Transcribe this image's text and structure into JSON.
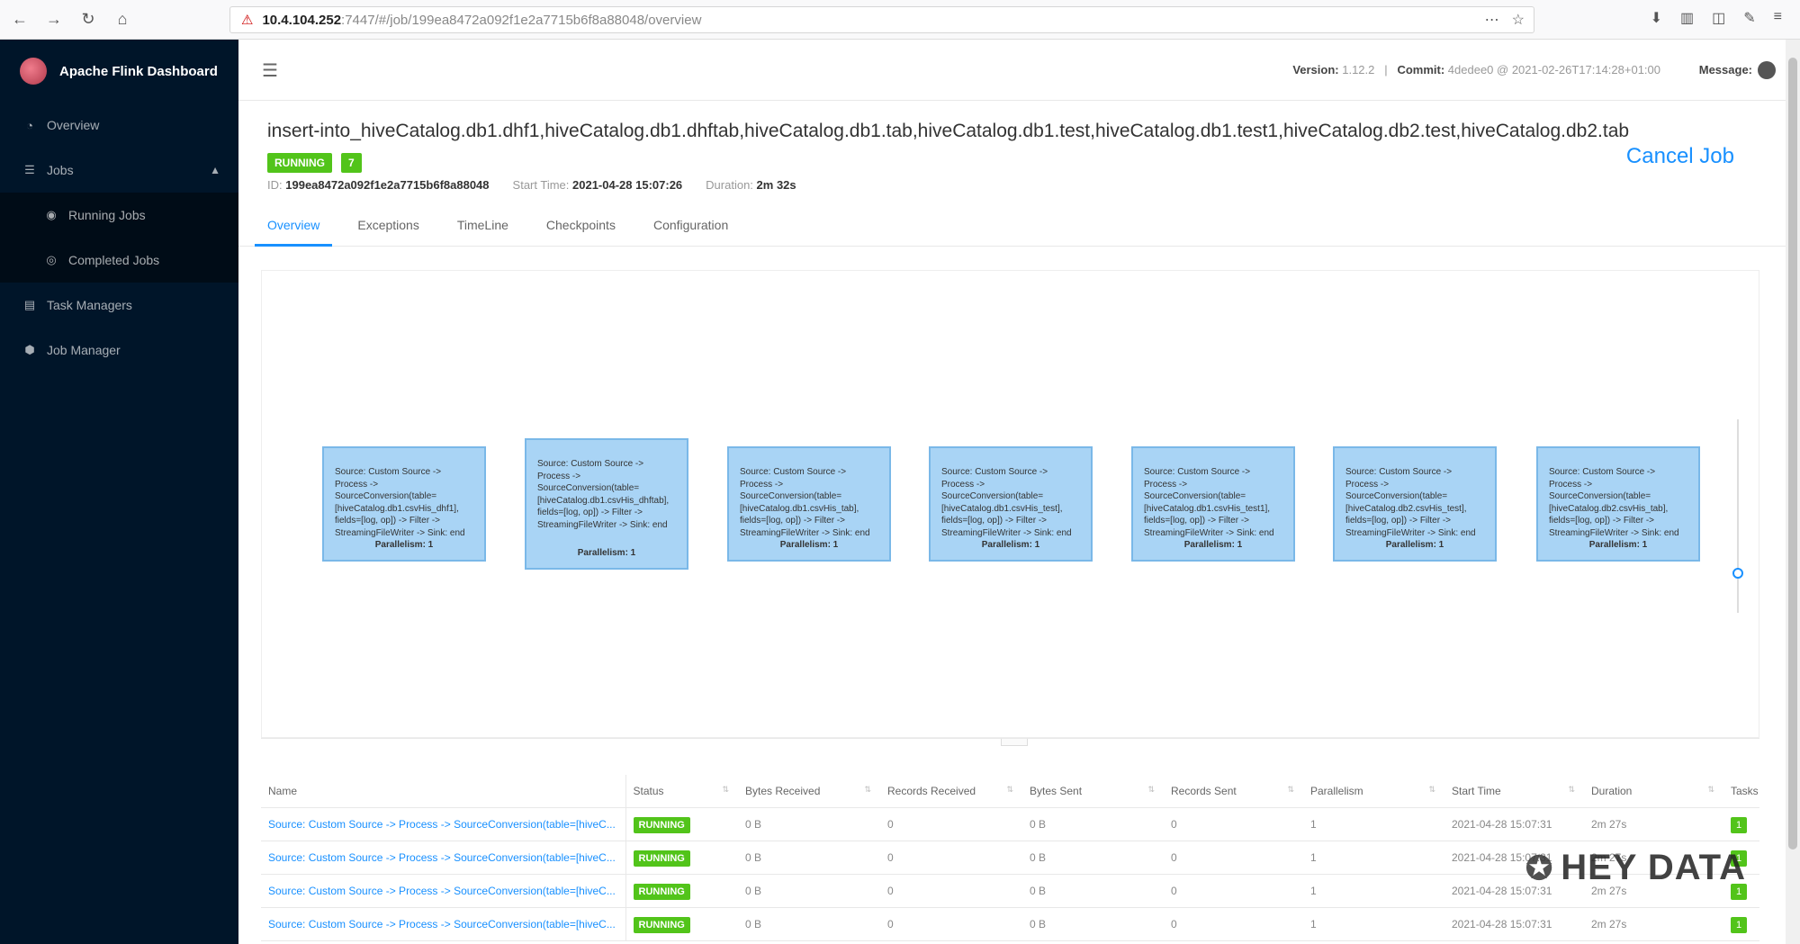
{
  "browser": {
    "url_host": "10.4.104.252",
    "url_path": ":7447/#/job/199ea8472a092f1e2a7715b6f8a88048/overview"
  },
  "sidebar": {
    "app_title": "Apache Flink Dashboard",
    "items": [
      {
        "label": "Overview",
        "icon": "dashboard-icon"
      },
      {
        "label": "Jobs",
        "icon": "list-icon"
      },
      {
        "label": "Running Jobs",
        "icon": "play-circle-icon"
      },
      {
        "label": "Completed Jobs",
        "icon": "check-circle-icon"
      },
      {
        "label": "Task Managers",
        "icon": "server-icon"
      },
      {
        "label": "Job Manager",
        "icon": "cluster-icon"
      }
    ]
  },
  "topbar": {
    "version_label": "Version:",
    "version_value": "1.12.2",
    "commit_label": "Commit:",
    "commit_value": "4dedee0 @ 2021-02-26T17:14:28+01:00",
    "message_label": "Message:"
  },
  "job": {
    "title": "insert-into_hiveCatalog.db1.dhf1,hiveCatalog.db1.dhftab,hiveCatalog.db1.tab,hiveCatalog.db1.test,hiveCatalog.db1.test1,hiveCatalog.db2.test,hiveCatalog.db2.tab",
    "status": "RUNNING",
    "task_count": "7",
    "id_label": "ID:",
    "id": "199ea8472a092f1e2a7715b6f8a88048",
    "start_time_label": "Start Time:",
    "start_time": "2021-04-28 15:07:26",
    "duration_label": "Duration:",
    "duration": "2m 32s",
    "cancel_label": "Cancel Job"
  },
  "tabs": [
    "Overview",
    "Exceptions",
    "TimeLine",
    "Checkpoints",
    "Configuration"
  ],
  "graph_nodes": [
    {
      "text": "Source: Custom Source -> Process -> SourceConversion(table=[hiveCatalog.db1.csvHis_dhf1], fields=[log, op]) -> Filter -> StreamingFileWriter -> Sink: end",
      "parallelism": "Parallelism: 1"
    },
    {
      "text": "Source: Custom Source -> Process -> SourceConversion(table=[hiveCatalog.db1.csvHis_dhftab], fields=[log, op]) -> Filter -> StreamingFileWriter -> Sink: end",
      "parallelism": "Parallelism: 1"
    },
    {
      "text": "Source: Custom Source -> Process -> SourceConversion(table=[hiveCatalog.db1.csvHis_tab], fields=[log, op]) -> Filter -> StreamingFileWriter -> Sink: end",
      "parallelism": "Parallelism: 1"
    },
    {
      "text": "Source: Custom Source -> Process -> SourceConversion(table=[hiveCatalog.db1.csvHis_test], fields=[log, op]) -> Filter -> StreamingFileWriter -> Sink: end",
      "parallelism": "Parallelism: 1"
    },
    {
      "text": "Source: Custom Source -> Process -> SourceConversion(table=[hiveCatalog.db1.csvHis_test1], fields=[log, op]) -> Filter -> StreamingFileWriter -> Sink: end",
      "parallelism": "Parallelism: 1"
    },
    {
      "text": "Source: Custom Source -> Process -> SourceConversion(table=[hiveCatalog.db2.csvHis_test], fields=[log, op]) -> Filter -> StreamingFileWriter -> Sink: end",
      "parallelism": "Parallelism: 1"
    },
    {
      "text": "Source: Custom Source -> Process -> SourceConversion(table=[hiveCatalog.db2.csvHis_tab], fields=[log, op]) -> Filter -> StreamingFileWriter -> Sink: end",
      "parallelism": "Parallelism: 1"
    }
  ],
  "table": {
    "headers": [
      "Name",
      "Status",
      "Bytes Received",
      "Records Received",
      "Bytes Sent",
      "Records Sent",
      "Parallelism",
      "Start Time",
      "Duration",
      "Tasks"
    ],
    "rows": [
      [
        "Source: Custom Source -> Process -> SourceConversion(table=[hiveC...",
        "RUNNING",
        "0 B",
        "0",
        "0 B",
        "0",
        "1",
        "2021-04-28 15:07:31",
        "2m 27s",
        "1"
      ],
      [
        "Source: Custom Source -> Process -> SourceConversion(table=[hiveC...",
        "RUNNING",
        "0 B",
        "0",
        "0 B",
        "0",
        "1",
        "2021-04-28 15:07:31",
        "2m 27s",
        "1"
      ],
      [
        "Source: Custom Source -> Process -> SourceConversion(table=[hiveC...",
        "RUNNING",
        "0 B",
        "0",
        "0 B",
        "0",
        "1",
        "2021-04-28 15:07:31",
        "2m 27s",
        "1"
      ],
      [
        "Source: Custom Source -> Process -> SourceConversion(table=[hiveC...",
        "RUNNING",
        "0 B",
        "0",
        "0 B",
        "0",
        "1",
        "2021-04-28 15:07:31",
        "2m 27s",
        "1"
      ]
    ]
  },
  "watermark": "HEY DATA",
  "colors": {
    "sidebar": "#001529",
    "accent": "#1890ff",
    "running": "#52c41a",
    "node": "#a9d4f5"
  }
}
